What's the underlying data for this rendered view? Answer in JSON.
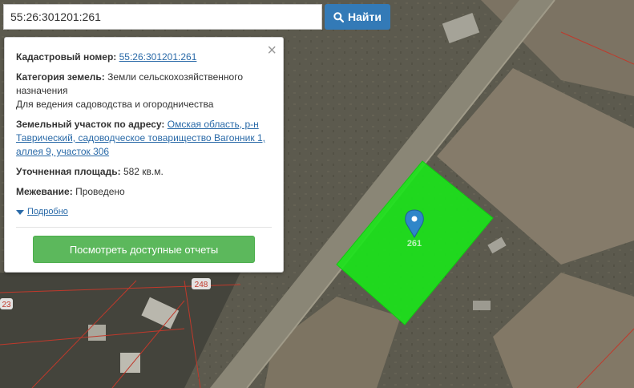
{
  "search": {
    "value": "55:26:301201:261",
    "button_label": "Найти"
  },
  "popup": {
    "cadastral_label": "Кадастровый номер:",
    "cadastral_value": "55:26:301201:261",
    "category_label": "Категория земель:",
    "category_value": "Земли сельскохозяйственного назначения",
    "usage_value": "Для ведения садоводства и огородничества",
    "address_label": "Земельный участок по адресу:",
    "address_value": "Омская область, р-н Таврический, садоводческое товарищество Вагонник 1, аллея 9, участок 306",
    "area_label": "Уточненная площадь:",
    "area_value": "582 кв.м.",
    "survey_label": "Межевание:",
    "survey_value": "Проведено",
    "more_label": "Подробно",
    "reports_button": "Посмотреть доступные отчеты"
  },
  "map": {
    "parcel_labels": [
      "261",
      "248",
      "23"
    ],
    "parcel_color": "#19e619",
    "boundary_color": "#c0392b",
    "marker_color": "#2f86c9"
  }
}
